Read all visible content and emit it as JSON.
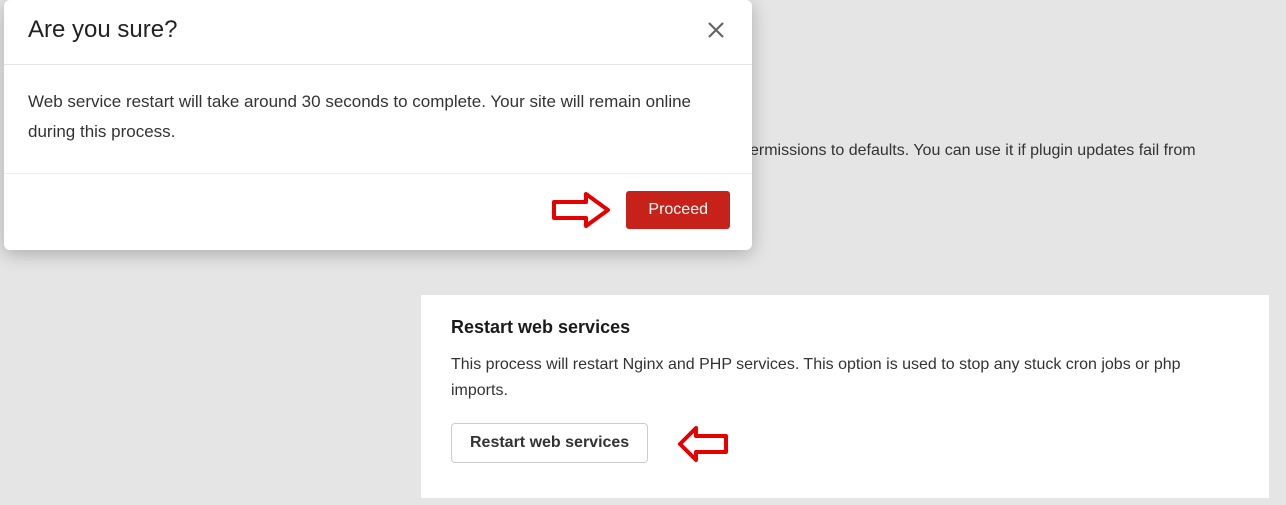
{
  "modal": {
    "title": "Are you sure?",
    "body": "Web service restart will take around 30 seconds to complete. Your site will remain online during this process.",
    "proceed_label": "Proceed"
  },
  "background": {
    "partial_text": "ermissions to defaults. You can use it if plugin updates fail from",
    "card": {
      "heading": "Restart web services",
      "description": "This process will restart Nginx and PHP services. This option is used to stop any stuck cron jobs or php imports.",
      "button_label": "Restart web services"
    }
  }
}
